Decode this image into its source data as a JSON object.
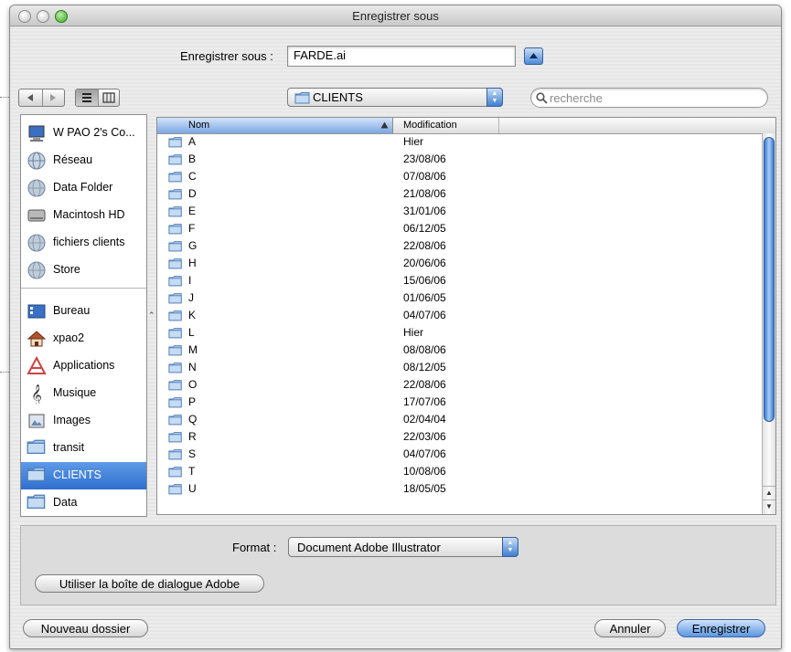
{
  "window": {
    "title": "Enregistrer sous"
  },
  "saveas": {
    "label": "Enregistrer sous :",
    "filename": "FARDE.ai"
  },
  "location": {
    "folder": "CLIENTS"
  },
  "search": {
    "placeholder": "recherche"
  },
  "sidebar": {
    "devices": [
      {
        "label": "W PAO 2's Co...",
        "icon": "computer-icon"
      },
      {
        "label": "Réseau",
        "icon": "network-icon"
      },
      {
        "label": "Data Folder",
        "icon": "network-volume-icon"
      },
      {
        "label": "Macintosh HD",
        "icon": "hard-drive-icon"
      },
      {
        "label": "fichiers clients",
        "icon": "network-volume-icon"
      },
      {
        "label": "Store",
        "icon": "network-volume-icon"
      }
    ],
    "places": [
      {
        "label": "Bureau",
        "icon": "desktop-icon"
      },
      {
        "label": "xpao2",
        "icon": "home-icon"
      },
      {
        "label": "Applications",
        "icon": "applications-icon"
      },
      {
        "label": "Musique",
        "icon": "music-icon"
      },
      {
        "label": "Images",
        "icon": "pictures-icon"
      },
      {
        "label": "transit",
        "icon": "folder-icon"
      },
      {
        "label": "CLIENTS",
        "icon": "folder-icon",
        "selected": true
      },
      {
        "label": "Data",
        "icon": "folder-icon"
      }
    ]
  },
  "columns": {
    "name": "Nom",
    "modified": "Modification"
  },
  "files": [
    {
      "name": "A",
      "date": "Hier"
    },
    {
      "name": "B",
      "date": "23/08/06"
    },
    {
      "name": "C",
      "date": "07/08/06"
    },
    {
      "name": "D",
      "date": "21/08/06"
    },
    {
      "name": "E",
      "date": "31/01/06"
    },
    {
      "name": "F",
      "date": "06/12/05"
    },
    {
      "name": "G",
      "date": "22/08/06"
    },
    {
      "name": "H",
      "date": "20/06/06"
    },
    {
      "name": "I",
      "date": "15/06/06"
    },
    {
      "name": "J",
      "date": "01/06/05"
    },
    {
      "name": "K",
      "date": "04/07/06"
    },
    {
      "name": "L",
      "date": "Hier"
    },
    {
      "name": "M",
      "date": "08/08/06"
    },
    {
      "name": "N",
      "date": "08/12/05"
    },
    {
      "name": "O",
      "date": "22/08/06"
    },
    {
      "name": "P",
      "date": "17/07/06"
    },
    {
      "name": "Q",
      "date": "02/04/04"
    },
    {
      "name": "R",
      "date": "22/03/06"
    },
    {
      "name": "S",
      "date": "04/07/06"
    },
    {
      "name": "T",
      "date": "10/08/06"
    },
    {
      "name": "U",
      "date": "18/05/05"
    }
  ],
  "format": {
    "label": "Format :",
    "value": "Document Adobe Illustrator"
  },
  "buttons": {
    "adobe_dialog": "Utiliser la boîte de dialogue Adobe",
    "new_folder": "Nouveau dossier",
    "cancel": "Annuler",
    "save": "Enregistrer"
  },
  "colors": {
    "selection": "#2f6fcf",
    "accent": "#4d8ad6",
    "window": "#ececec"
  }
}
